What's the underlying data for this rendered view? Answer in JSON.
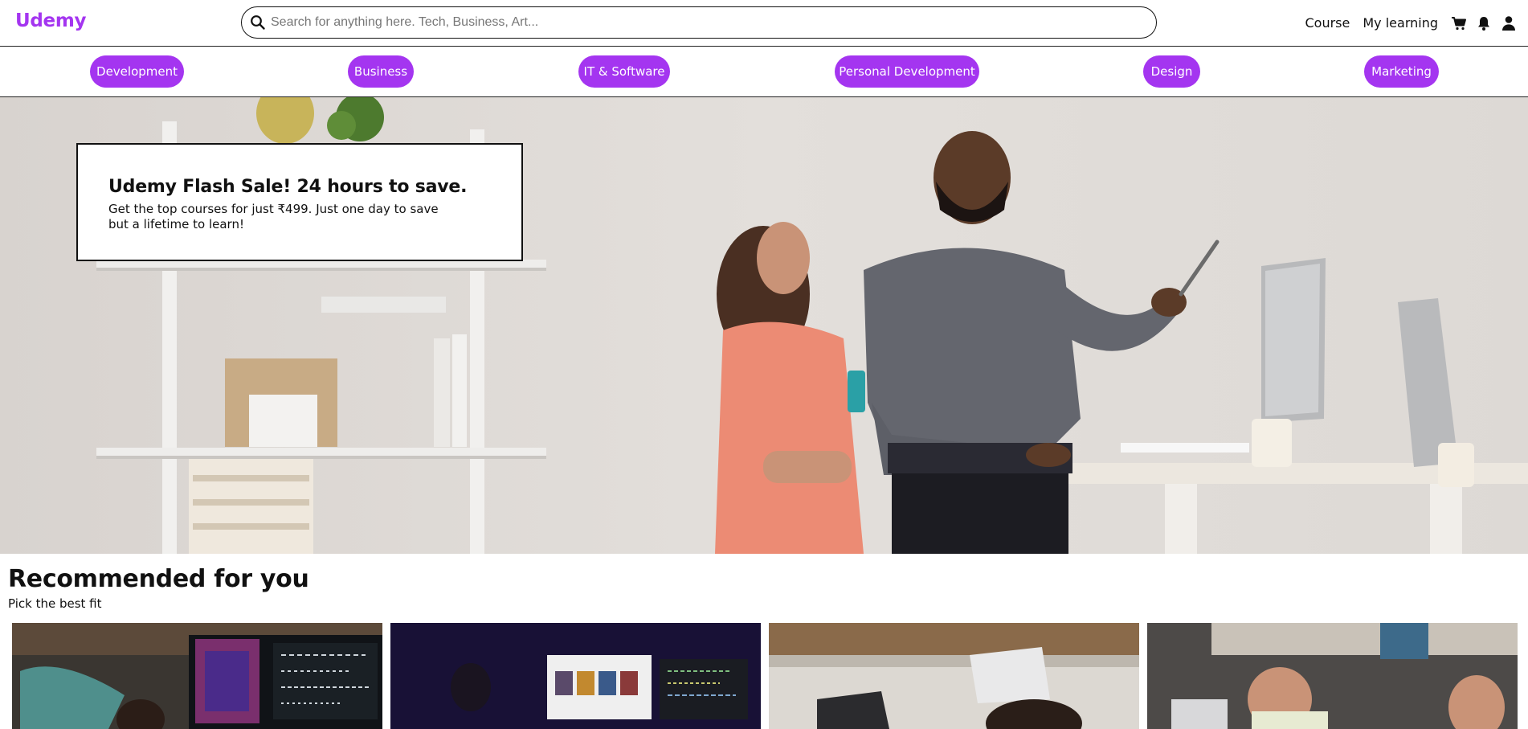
{
  "header": {
    "logo": "Udemy",
    "search_placeholder": "Search for anything here. Tech, Business, Art...",
    "links": {
      "course": "Course",
      "my_learning": "My learning"
    }
  },
  "categories": [
    "Development",
    "Business",
    "IT & Software",
    "Personal Development",
    "Design",
    "Marketing"
  ],
  "hero": {
    "promo_title": "Udemy Flash Sale! 24 hours to save.",
    "promo_text": "Get the top courses for just ₹499. Just one day to save but a lifetime to learn!"
  },
  "recommended": {
    "title": "Recommended for you",
    "subtitle": "Pick the best fit"
  },
  "colors": {
    "accent": "#a435f0",
    "text": "#111111",
    "hero_bg": "#d9d5d1"
  },
  "icons": [
    "search-icon",
    "cart-icon",
    "bell-icon",
    "user-icon"
  ]
}
